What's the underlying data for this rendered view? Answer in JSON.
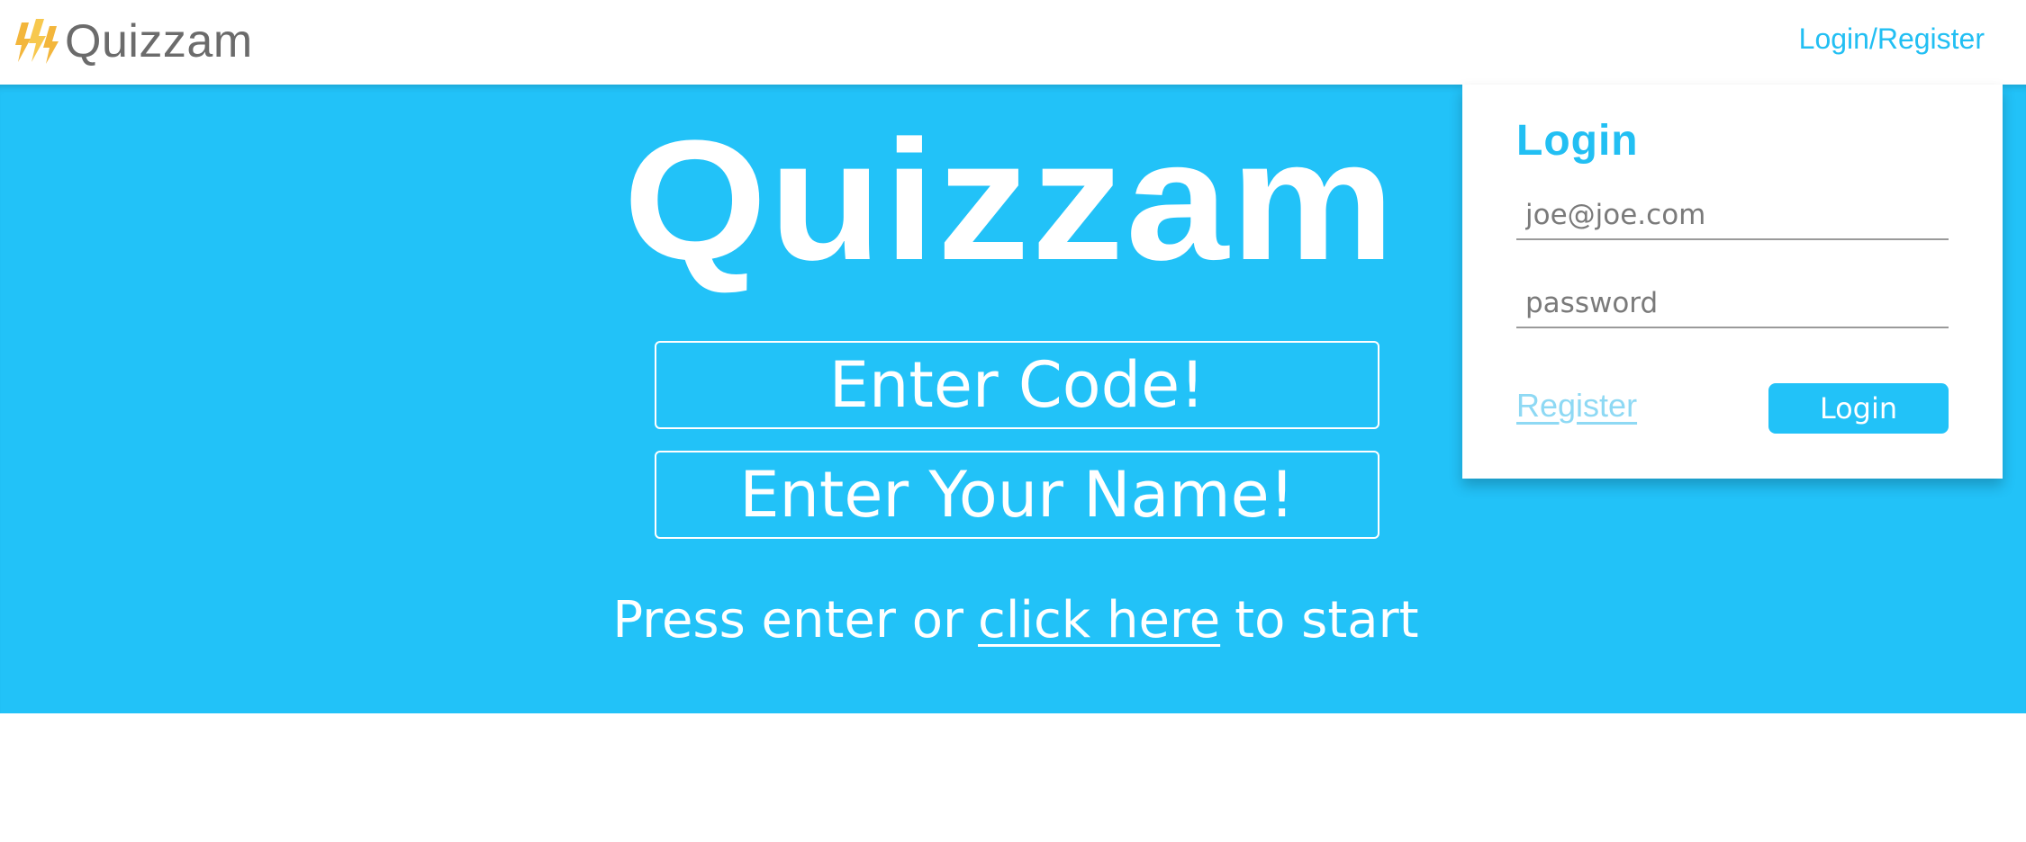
{
  "app": {
    "brand_name": "Quizzam",
    "brand_icon": "lightning-bolts-icon",
    "accent_color": "#22c2f8"
  },
  "navbar": {
    "login_register_link": "Login/Register"
  },
  "hero": {
    "title": "Quizzam",
    "code_input": {
      "placeholder": "Enter Code!",
      "value": ""
    },
    "name_input": {
      "placeholder": "Enter Your Name!",
      "value": ""
    },
    "start_prefix": "Press enter or",
    "start_link": "click here",
    "start_suffix": "to start"
  },
  "login_panel": {
    "heading": "Login",
    "email_field": {
      "placeholder": "joe@joe.com",
      "value": ""
    },
    "password_field": {
      "placeholder": "password",
      "value": ""
    },
    "register_link": "Register",
    "login_button": "Login"
  }
}
